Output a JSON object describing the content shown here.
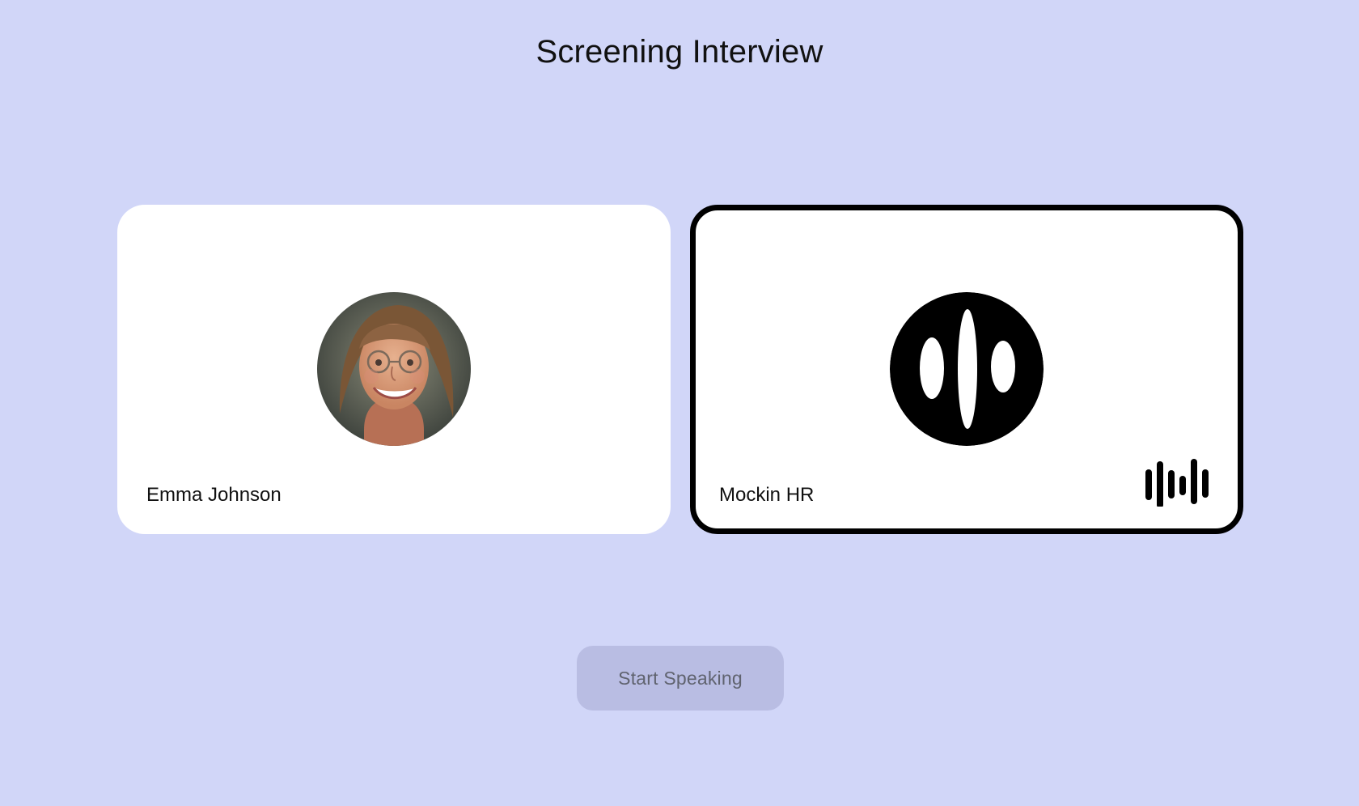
{
  "page": {
    "title": "Screening Interview"
  },
  "participants": [
    {
      "name": "Emma Johnson",
      "avatar_icon": "user-photo-avatar"
    },
    {
      "name": "Mockin HR",
      "avatar_icon": "mockin-logo",
      "status_icon": "audio-waveform-icon"
    }
  ],
  "controls": {
    "start_speaking_label": "Start Speaking"
  },
  "colors": {
    "background": "#d1d6f8",
    "card": "#ffffff",
    "active_border": "#000000",
    "button_background": "#b9bde3",
    "button_text": "#60636f"
  }
}
